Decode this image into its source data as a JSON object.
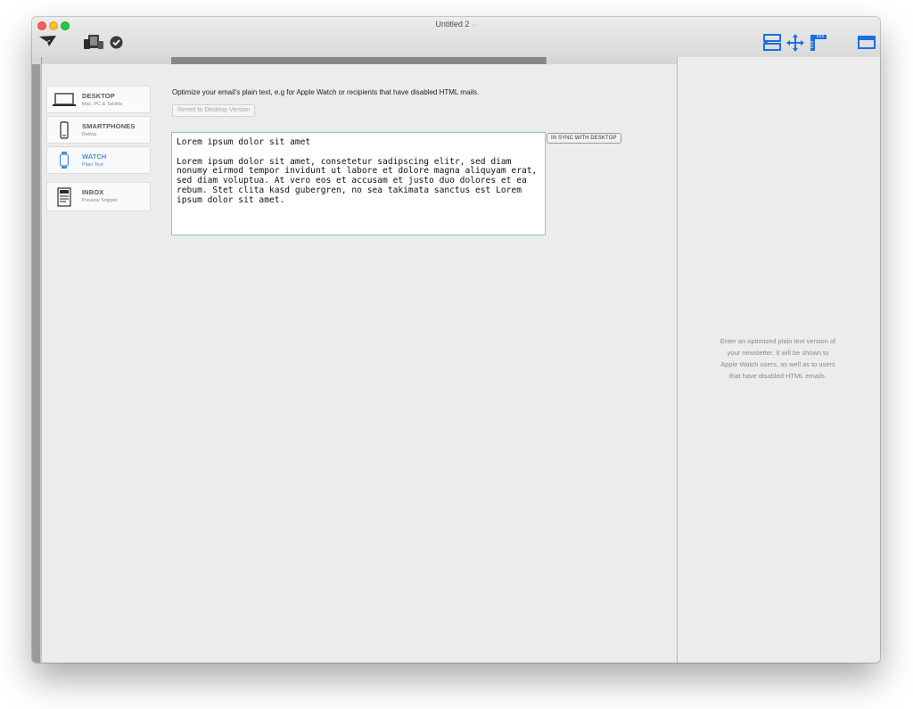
{
  "window": {
    "title": "Untitled 2",
    "title_chevron": "⌵"
  },
  "toolbar": {
    "left_icons": [
      "send-icon",
      "devices-icon",
      "checkmark-icon"
    ],
    "right_icons": [
      "layout-icon",
      "move-icon",
      "ruler-icon",
      "panel-icon"
    ],
    "accent_color": "#1d6fe0"
  },
  "sidebar": {
    "items": [
      {
        "label": "DESKTOP",
        "sub": "Mac, PC & Tablets",
        "icon": "laptop-icon"
      },
      {
        "label": "SMARTPHONES",
        "sub": "Retina",
        "icon": "smartphone-icon"
      },
      {
        "label": "WATCH",
        "sub": "Plain Text",
        "icon": "watch-icon",
        "active": true
      },
      {
        "label": "INBOX",
        "sub": "Preview Snippet",
        "icon": "inbox-icon"
      }
    ],
    "active_color": "#4a90d9"
  },
  "main": {
    "hint": "Optimize your email's plain text, e.g for Apple Watch or recipients that have disabled HTML mails.",
    "revert_label": "Revert to Desktop Version",
    "sync_badge": "IN SYNC WITH DESKTOP",
    "editor": {
      "line1": "Lorem ipsum dolor sit amet",
      "body": "Lorem ipsum dolor sit amet, consetetur sadipscing elitr, sed diam nonumy eirmod tempor invidunt ut labore et dolore magna aliquyam erat, sed diam voluptua. At vero eos et accusam et justo duo dolores et ea rebum. Stet clita kasd gubergren, no sea takimata sanctus est Lorem ipsum dolor sit amet."
    }
  },
  "right_panel": {
    "message_lines": [
      "Enter an optimized plain text version of",
      "your newsletter. It will be shown to",
      "Apple Watch users, as well as to users",
      "that have disabled HTML emails."
    ]
  }
}
